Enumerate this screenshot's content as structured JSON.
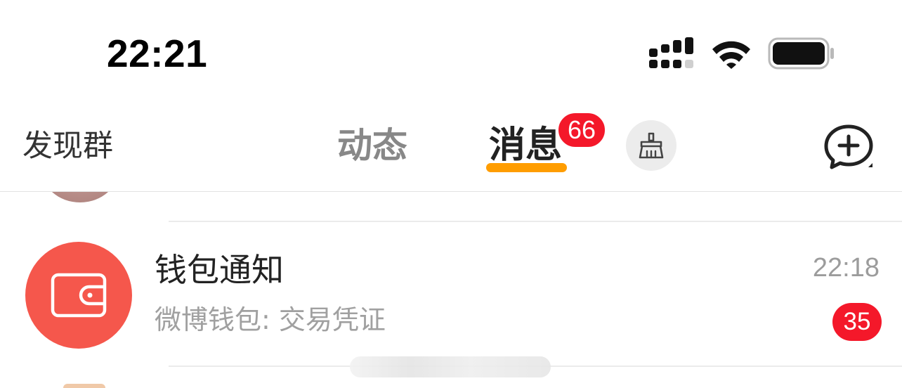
{
  "status_bar": {
    "time": "22:21",
    "icons": [
      "signal-icon",
      "wifi-icon",
      "battery-icon"
    ]
  },
  "nav": {
    "left_link": "发现群",
    "tabs": [
      {
        "label": "动态",
        "active": false
      },
      {
        "label": "消息",
        "active": true,
        "badge": "66"
      }
    ],
    "clean_icon": "broom-icon",
    "new_chat_icon": "chat-plus-icon"
  },
  "messages": [
    {
      "title": "钱包通知",
      "subtitle": "微博钱包: 交易凭证",
      "time": "22:18",
      "unread": "35",
      "avatar_icon": "wallet-icon"
    }
  ],
  "colors": {
    "accent_underline": "#ff9d00",
    "badge_red": "#f4182a",
    "wallet_avatar": "#f5574c"
  }
}
